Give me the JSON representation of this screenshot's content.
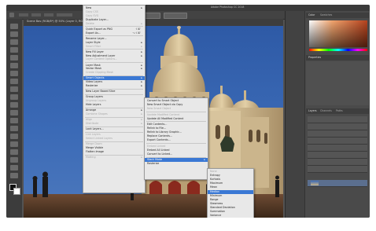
{
  "app": {
    "title": "Adobe Photoshop CC 2018",
    "document_tab": "Scene Bas (RGB/8*) @ 50% (Layer 0, RGB/8*)"
  },
  "menubar": {
    "items": [
      "",
      "",
      "",
      "",
      "",
      "",
      "",
      ""
    ]
  },
  "layer_menu": {
    "items": [
      {
        "label": "New",
        "state": "normal",
        "arrow": true
      },
      {
        "label": "Copy CSS",
        "state": "disabled"
      },
      {
        "label": "Copy SVG",
        "state": "disabled"
      },
      {
        "label": "Duplicate Layer...",
        "state": "normal"
      },
      {
        "label": "Delete",
        "state": "disabled",
        "arrow": true
      },
      {
        "sep": true
      },
      {
        "label": "Quick Export as PNG",
        "state": "normal",
        "shortcut": "⇧⌘'"
      },
      {
        "label": "Export As...",
        "state": "normal",
        "shortcut": "⌥⇧⌘'"
      },
      {
        "sep": true
      },
      {
        "label": "Rename Layer...",
        "state": "normal"
      },
      {
        "label": "Layer Style",
        "state": "normal",
        "arrow": true
      },
      {
        "label": "Smart Filter",
        "state": "disabled",
        "arrow": true
      },
      {
        "sep": true
      },
      {
        "label": "New Fill Layer",
        "state": "normal",
        "arrow": true
      },
      {
        "label": "New Adjustment Layer",
        "state": "normal",
        "arrow": true
      },
      {
        "label": "Layer Content Options...",
        "state": "disabled"
      },
      {
        "sep": true
      },
      {
        "label": "Layer Mask",
        "state": "normal",
        "arrow": true
      },
      {
        "label": "Vector Mask",
        "state": "normal",
        "arrow": true
      },
      {
        "label": "Create Clipping Mask",
        "state": "disabled"
      },
      {
        "sep": true
      },
      {
        "label": "Smart Objects",
        "state": "highlight",
        "arrow": true
      },
      {
        "label": "Video Layers",
        "state": "normal",
        "arrow": true
      },
      {
        "label": "Rasterize",
        "state": "normal",
        "arrow": true
      },
      {
        "sep": true
      },
      {
        "label": "New Layer Based Slice",
        "state": "normal"
      },
      {
        "sep": true
      },
      {
        "label": "Group Layers",
        "state": "normal"
      },
      {
        "label": "Ungroup Layers",
        "state": "disabled"
      },
      {
        "label": "Hide Layers",
        "state": "normal"
      },
      {
        "sep": true
      },
      {
        "label": "Arrange",
        "state": "normal",
        "arrow": true
      },
      {
        "label": "Combine Shapes",
        "state": "disabled",
        "arrow": true
      },
      {
        "sep": true
      },
      {
        "label": "Align",
        "state": "disabled",
        "arrow": true
      },
      {
        "label": "Distribute",
        "state": "disabled",
        "arrow": true
      },
      {
        "sep": true
      },
      {
        "label": "Lock Layers...",
        "state": "normal"
      },
      {
        "sep": true
      },
      {
        "label": "Link Layers",
        "state": "disabled"
      },
      {
        "label": "Select Linked Layers",
        "state": "disabled"
      },
      {
        "sep": true
      },
      {
        "label": "Merge Down",
        "state": "disabled"
      },
      {
        "label": "Merge Visible",
        "state": "normal"
      },
      {
        "label": "Flatten Image",
        "state": "normal"
      },
      {
        "sep": true
      },
      {
        "label": "Matting",
        "state": "disabled",
        "arrow": true
      }
    ]
  },
  "smart_objects_menu": {
    "items": [
      {
        "label": "Convert to Smart Object",
        "state": "normal"
      },
      {
        "label": "New Smart Object via Copy",
        "state": "normal"
      },
      {
        "label": "New Smart Object",
        "state": "disabled"
      },
      {
        "sep": true
      },
      {
        "label": "Update Modified Content",
        "state": "disabled"
      },
      {
        "label": "Update All Modified Content",
        "state": "normal"
      },
      {
        "sep": true
      },
      {
        "label": "Edit Contents...",
        "state": "normal"
      },
      {
        "label": "Relink to File...",
        "state": "normal"
      },
      {
        "label": "Relink to Library Graphic...",
        "state": "normal"
      },
      {
        "label": "Replace Contents...",
        "state": "normal"
      },
      {
        "label": "Export Contents...",
        "state": "normal"
      },
      {
        "sep": true
      },
      {
        "label": "Embed Linked",
        "state": "disabled"
      },
      {
        "label": "Embed All Linked",
        "state": "normal"
      },
      {
        "label": "Convert to Linked...",
        "state": "normal"
      },
      {
        "sep": true
      },
      {
        "label": "Stack Mode",
        "state": "highlight",
        "arrow": true
      },
      {
        "label": "Rasterize",
        "state": "normal"
      }
    ]
  },
  "stack_mode_menu": {
    "items": [
      {
        "label": "None",
        "state": "disabled"
      },
      {
        "label": "Entropy",
        "state": "normal"
      },
      {
        "label": "Kurtosis",
        "state": "normal"
      },
      {
        "label": "Maximum",
        "state": "normal"
      },
      {
        "label": "Mean",
        "state": "normal"
      },
      {
        "label": "Median",
        "state": "highlight"
      },
      {
        "label": "Minimum",
        "state": "normal"
      },
      {
        "label": "Range",
        "state": "normal"
      },
      {
        "label": "Skewness",
        "state": "normal"
      },
      {
        "label": "Standard Deviation",
        "state": "normal"
      },
      {
        "label": "Summation",
        "state": "normal"
      },
      {
        "label": "Variance",
        "state": "normal"
      }
    ]
  },
  "panels": {
    "color_tab": "Color",
    "swatches_tab": "Swatches",
    "properties_tab": "Properties",
    "layers_tab": "Layers",
    "channels_tab": "Channels",
    "paths_tab": "Paths"
  },
  "colors": {
    "highlight": "#3a78d4",
    "menu_bg": "#e8e8e8",
    "panel_bg": "#4a4a4a",
    "sky": "#3b6ab6",
    "stone": "#d7c29a"
  }
}
